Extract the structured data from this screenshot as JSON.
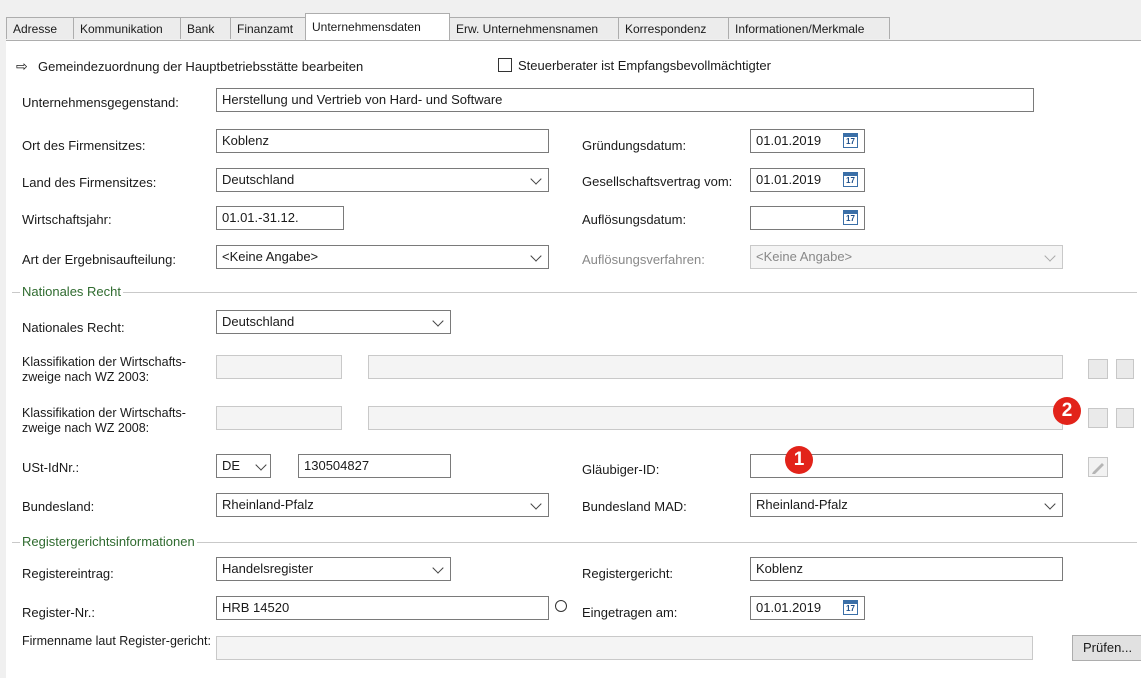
{
  "tabs": [
    "Adresse",
    "Kommunikation",
    "Bank",
    "Finanzamt",
    "Unternehmensdaten",
    "Erw. Unternehmensnamen",
    "Korrespondenz",
    "Informationen/Merkmale"
  ],
  "active_tab": "Unternehmensdaten",
  "link_gemeinde": "Gemeindezuordnung der Hauptbetriebsstätte bearbeiten",
  "checkbox_steuerberater": "Steuerberater ist Empfangsbevollmächtigter",
  "fields": {
    "unternehmensgegenstand": {
      "label": "Unternehmensgegenstand:",
      "value": "Herstellung und Vertrieb von Hard- und Software"
    },
    "ort": {
      "label": "Ort des Firmensitzes:",
      "value": "Koblenz"
    },
    "land": {
      "label": "Land des Firmensitzes:",
      "value": "Deutschland"
    },
    "wirtschaftsjahr": {
      "label": "Wirtschaftsjahr:",
      "value": "01.01.-31.12."
    },
    "ergebnis": {
      "label": "Art der Ergebnisaufteilung:",
      "value": "<Keine Angabe>"
    },
    "gruendung": {
      "label": "Gründungsdatum:",
      "value": "01.01.2019"
    },
    "gesellschaftsvertrag": {
      "label": "Gesellschaftsvertrag vom:",
      "value": "01.01.2019"
    },
    "aufloesungsdatum": {
      "label": "Auflösungsdatum:",
      "value": ""
    },
    "aufloesungsverfahren": {
      "label": "Auflösungsverfahren:",
      "value": "<Keine Angabe>"
    },
    "nationales_recht": {
      "label": "Nationales Recht:",
      "value": "Deutschland"
    },
    "wz2003": {
      "label": "Klassifikation der Wirtschafts-zweige nach WZ 2003:",
      "code": "",
      "text": ""
    },
    "wz2008": {
      "label": "Klassifikation der Wirtschafts-zweige nach WZ 2008:",
      "code": "",
      "text": ""
    },
    "ustid": {
      "label": "USt-IdNr.:",
      "country": "DE",
      "value": "130504827"
    },
    "glaeubiger": {
      "label": "Gläubiger-ID:",
      "value": ""
    },
    "bundesland": {
      "label": "Bundesland:",
      "value": "Rheinland-Pfalz"
    },
    "bundesland_mad": {
      "label": "Bundesland MAD:",
      "value": "Rheinland-Pfalz"
    },
    "registereintrag": {
      "label": "Registereintrag:",
      "value": "Handelsregister"
    },
    "registergericht": {
      "label": "Registergericht:",
      "value": "Koblenz"
    },
    "register_nr": {
      "label": "Register-Nr.:",
      "value": "HRB 14520"
    },
    "eingetragen": {
      "label": "Eingetragen am:",
      "value": "01.01.2019"
    },
    "firmenname": {
      "label": "Firmenname laut Register-gericht:",
      "value": ""
    }
  },
  "groups": {
    "nationales": "Nationales Recht",
    "register": "Registergerichtsinformationen"
  },
  "calendar_glyph": "17",
  "markers": {
    "one": "1",
    "two": "2"
  },
  "pruefen_label": "Prüfen...",
  "colors": {
    "marker": "#e2231a",
    "group_title": "#2f6b2f"
  }
}
